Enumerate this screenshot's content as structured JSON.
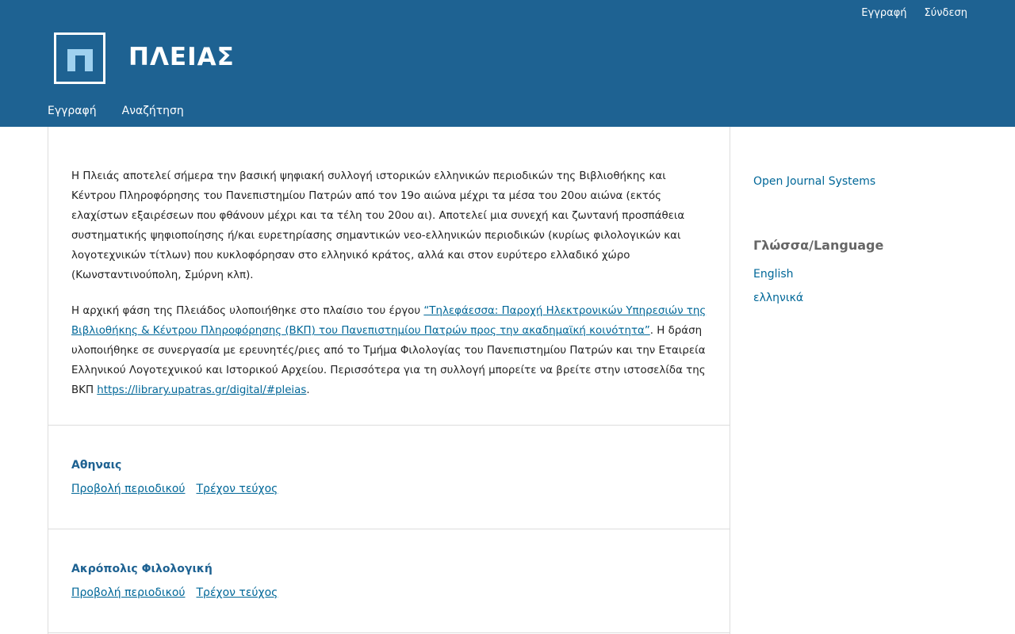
{
  "header": {
    "user_nav": {
      "register": "Εγγραφή",
      "login": "Σύνδεση"
    },
    "site_name": "ΠΛΕΙΑΣ",
    "logo_icon": "pi-letter-logo-icon",
    "primary_nav": {
      "register": "Εγγραφή",
      "search": "Αναζήτηση"
    },
    "bg_color": "#1e6292"
  },
  "about": {
    "paragraph1": "Η Πλειάς αποτελεί σήμερα την βασική ψηφιακή συλλογή ιστορικών ελληνικών περιοδικών της Βιβλιοθήκης και Κέντρου Πληροφόρησης του Πανεπιστημίου Πατρών από τον 19ο αιώνα μέχρι τα μέσα του 20ου αιώνα (εκτός ελαχίστων εξαιρέσεων που φθάνουν μέχρι και τα τέλη του 20ου αι). Αποτελεί μια συνεχή και ζωντανή προσπάθεια συστηματικής ψηφιοποίησης ή/και ευρετηρίασης σημαντικών νεο-ελληνικών περιοδικών (κυρίως φιλολογικών και λογοτεχνικών τίτλων) που κυκλοφόρησαν στο ελληνικό κράτος, αλλά και στον ευρύτερο ελλαδικό χώρο (Κωνσταντινούπολη, Σμύρνη κλπ).",
    "paragraph2_before": "Η αρχική φάση της Πλειάδος υλοποιήθηκε στο πλαίσιο του έργου ",
    "project_link": "“Τηλεφάεσσα: Παροχή Ηλεκτρονικών Υπηρεσιών της Βιβλιοθήκης & Κέντρου Πληροφόρησης (ΒΚΠ) του Πανεπιστημίου Πατρών προς την ακαδημαϊκή κοινότητα”",
    "paragraph2_after": ". Η δράση υλοποιήθηκε σε συνεργασία με ερευνητές/ριες από το Τμήμα Φιλολογίας του Πανεπιστημίου Πατρών και την Εταιρεία Ελληνικού Λογοτεχνικού και Ιστορικού Αρχείου. Περισσότερα για τη συλλογή μπορείτε να βρείτε στην ιστοσελίδα της ΒΚΠ ",
    "library_link": "https://library.upatras.gr/digital/#pleias",
    "paragraph2_end": "."
  },
  "journals": [
    {
      "title": "Αθηναις",
      "view_label": "Προβολή περιοδικού",
      "current_label": "Τρέχον τεύχος"
    },
    {
      "title": "Ακρόπολις Φιλολογική",
      "view_label": "Προβολή περιοδικού",
      "current_label": "Τρέχον τεύχος"
    }
  ],
  "sidebar": {
    "ojs_link": "Open Journal Systems",
    "language_title": "Γλώσσα/Language",
    "languages": [
      "English",
      "ελληνικά"
    ]
  }
}
